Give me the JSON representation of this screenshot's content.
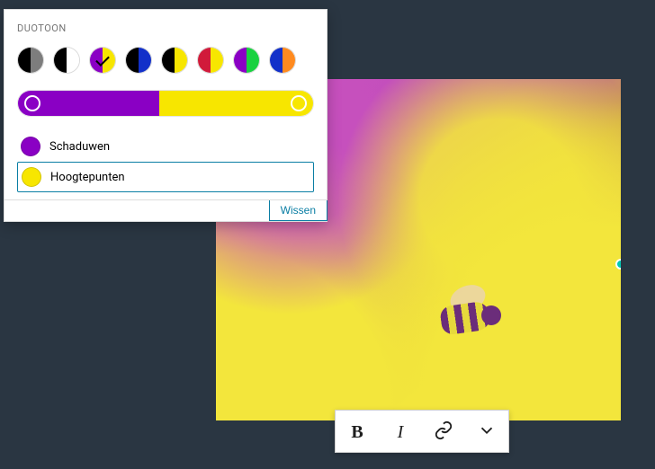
{
  "panel": {
    "title": "DUOTOON",
    "swatches": [
      {
        "a": "#000000",
        "b": "#7d7d7d",
        "selected": false
      },
      {
        "a": "#000000",
        "b": "#ffffff",
        "selected": false
      },
      {
        "a": "#8a00c4",
        "b": "#f7e600",
        "selected": true
      },
      {
        "a": "#000000",
        "b": "#1230c9",
        "selected": false
      },
      {
        "a": "#000000",
        "b": "#f7e600",
        "selected": false
      },
      {
        "a": "#d11a3a",
        "b": "#f7e600",
        "selected": false
      },
      {
        "a": "#8a00c4",
        "b": "#19d140",
        "selected": false
      },
      {
        "a": "#1230c9",
        "b": "#ff8a1f",
        "selected": false
      }
    ],
    "gradient": {
      "shadow": "#8a00c4",
      "highlight": "#f7e600"
    },
    "shadows_label": "Schaduwen",
    "highlights_label": "Hoogtepunten",
    "clear_label": "Wissen",
    "shadow_color": "#8a00c4",
    "highlight_color": "#f7e600"
  },
  "toolbar": {
    "bold": "B",
    "italic": "I"
  }
}
